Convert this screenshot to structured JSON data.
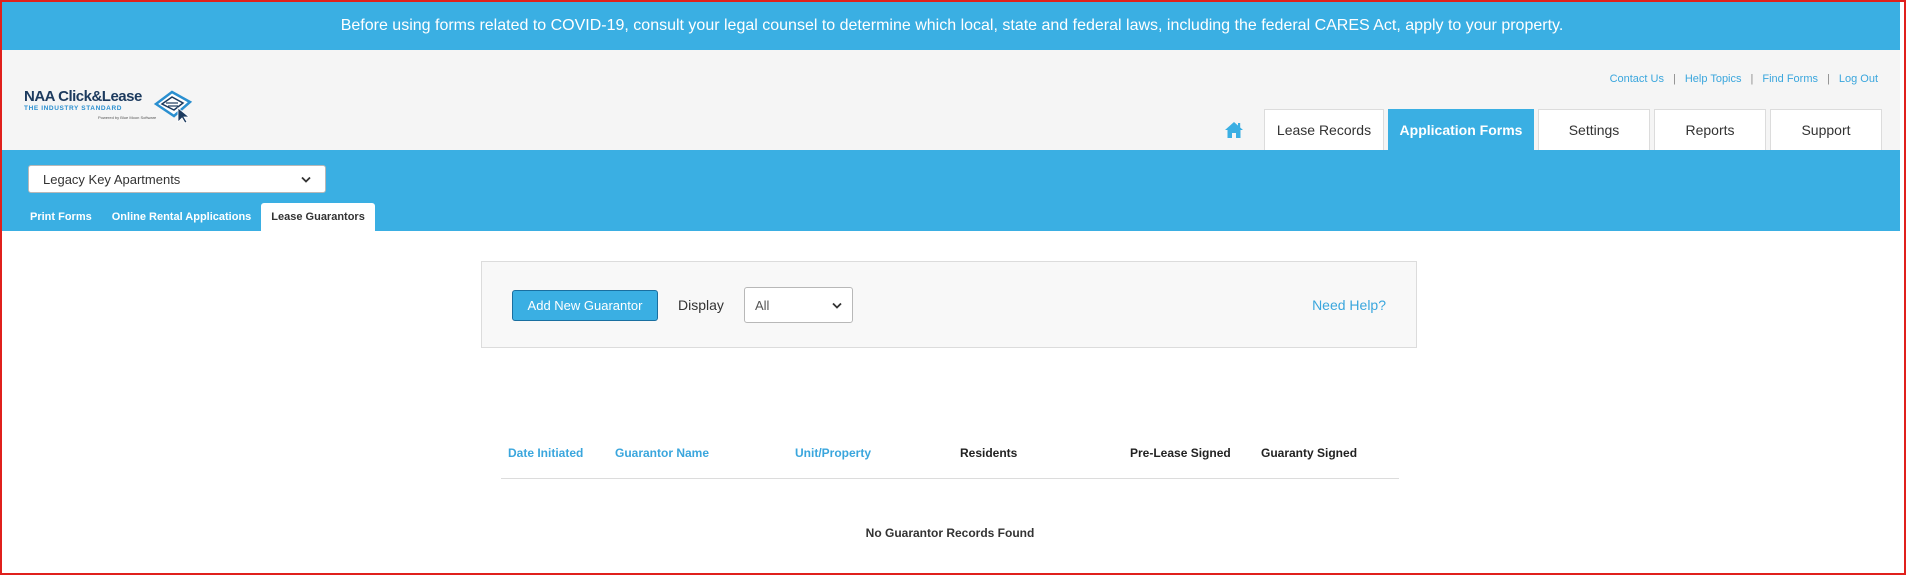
{
  "banner": {
    "text": "Before using forms related to COVID-19, consult your legal counsel to determine which local, state and federal laws, including the federal CARES Act, apply to your property."
  },
  "logo": {
    "brand": "NAA Click&Lease",
    "tagline": "THE INDUSTRY STANDARD",
    "powered": "Powered by Blue Moon Software"
  },
  "util_links": [
    {
      "label": "Contact Us"
    },
    {
      "label": "Help Topics"
    },
    {
      "label": "Find Forms"
    },
    {
      "label": "Log Out"
    }
  ],
  "nav": {
    "home_icon": "home-icon",
    "tabs": [
      {
        "label": "Lease Records",
        "active": false
      },
      {
        "label": "Application Forms",
        "active": true
      },
      {
        "label": "Settings",
        "active": false
      },
      {
        "label": "Reports",
        "active": false
      },
      {
        "label": "Support",
        "active": false
      }
    ]
  },
  "property_select": {
    "value": "Legacy Key Apartments"
  },
  "sub_tabs": [
    {
      "label": "Print Forms",
      "active": false
    },
    {
      "label": "Online Rental Applications",
      "active": false
    },
    {
      "label": "Lease Guarantors",
      "active": true
    }
  ],
  "toolbar": {
    "add_label": "Add New Guarantor",
    "display_label": "Display",
    "display_value": "All",
    "help_label": "Need Help?"
  },
  "table": {
    "columns": [
      {
        "label": "Date Initiated",
        "sortable": true
      },
      {
        "label": "Guarantor Name",
        "sortable": true
      },
      {
        "label": "Unit/Property",
        "sortable": true
      },
      {
        "label": "Residents",
        "sortable": false
      },
      {
        "label": "Pre-Lease Signed",
        "sortable": false
      },
      {
        "label": "Guaranty Signed",
        "sortable": false
      }
    ],
    "empty_message": "No Guarantor Records Found"
  },
  "colors": {
    "accent": "#3aafe3",
    "link": "#3aa6dd",
    "frame_border": "#e0201c",
    "header_bg": "#f5f5f5",
    "logo_navy": "#1c3a5e"
  }
}
